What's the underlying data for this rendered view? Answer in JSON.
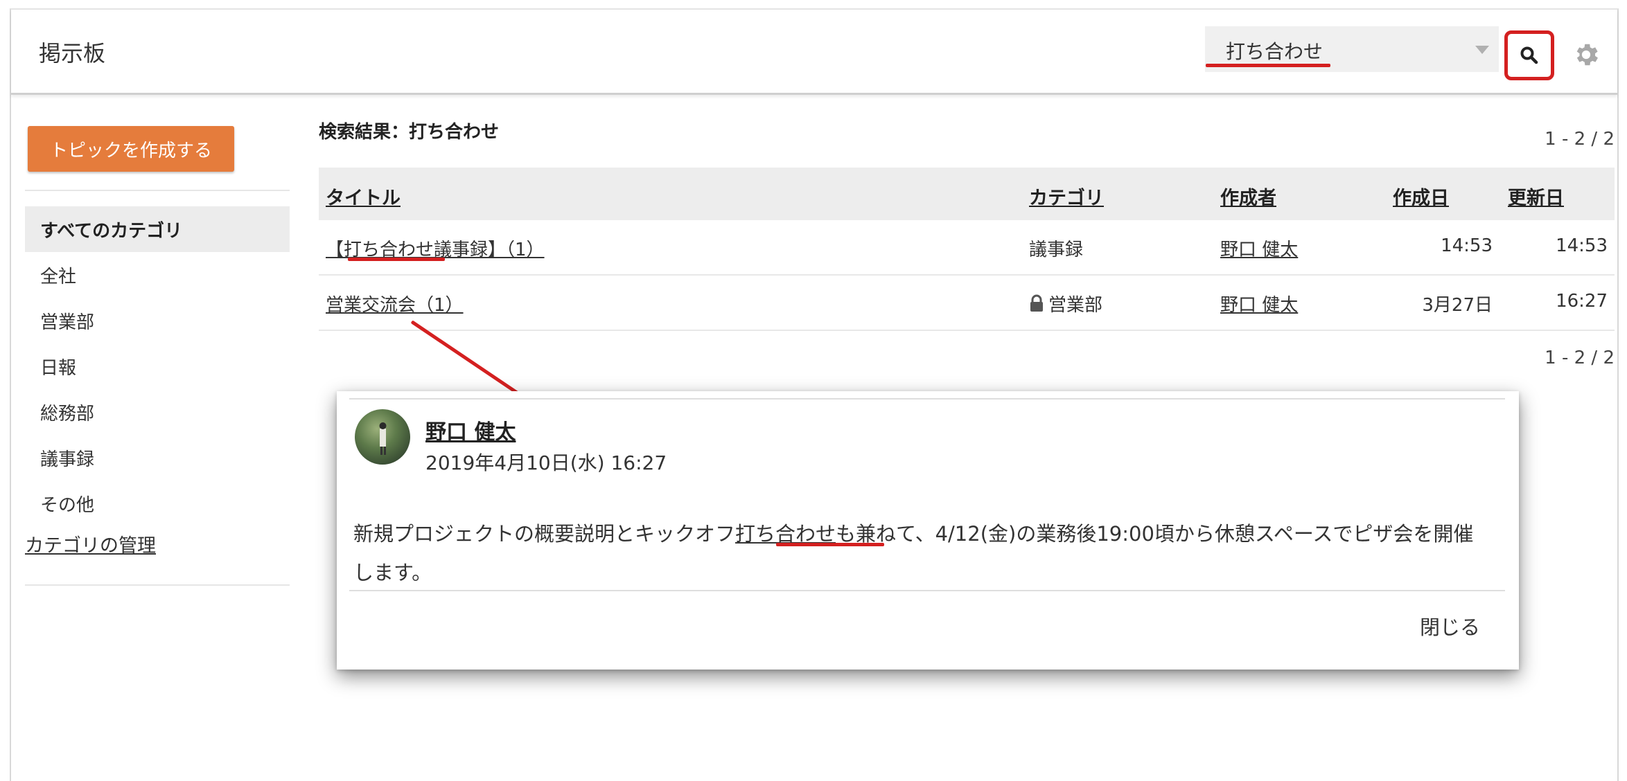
{
  "header": {
    "app_title": "掲示板",
    "search_value": "打ち合わせ"
  },
  "sidebar": {
    "create_button": "トピックを作成する",
    "categories": [
      "すべてのカテゴリ",
      "全社",
      "営業部",
      "日報",
      "総務部",
      "議事録",
      "その他"
    ],
    "manage_link": "カテゴリの管理"
  },
  "main": {
    "results_title": "検索結果：打ち合わせ",
    "pager_top": "1 - 2 / 2",
    "pager_bottom": "1 - 2 / 2",
    "columns": [
      "タイトル",
      "カテゴリ",
      "作成者",
      "作成日",
      "更新日"
    ],
    "rows": [
      {
        "title": "【打ち合わせ議事録】（1）",
        "category": "議事録",
        "author": "野口 健太",
        "created": "14:53",
        "updated": "14:53"
      },
      {
        "title": "営業交流会（1）",
        "category": "営業部",
        "author": "野口 健太",
        "created": "3月27日",
        "updated": "16:27"
      }
    ]
  },
  "popup": {
    "author": "野口 健太",
    "date": "2019年4月10日(水) 16:27",
    "body_before": "新規プロジェクトの概要説明とキックオフ",
    "body_highlight": "打ち合わせ",
    "body_after": "も兼ねて、4/12(金)の業務後19:00頃から休憩スペースでピザ会を開催します。",
    "close_label": "閉じる"
  },
  "colors": {
    "accent_orange": "#e57c3c",
    "annotation_red": "#d42020"
  },
  "icons": {
    "search": "search-icon",
    "settings": "gear-icon",
    "lock": "lock-icon",
    "dropdown": "chevron-down-icon"
  }
}
